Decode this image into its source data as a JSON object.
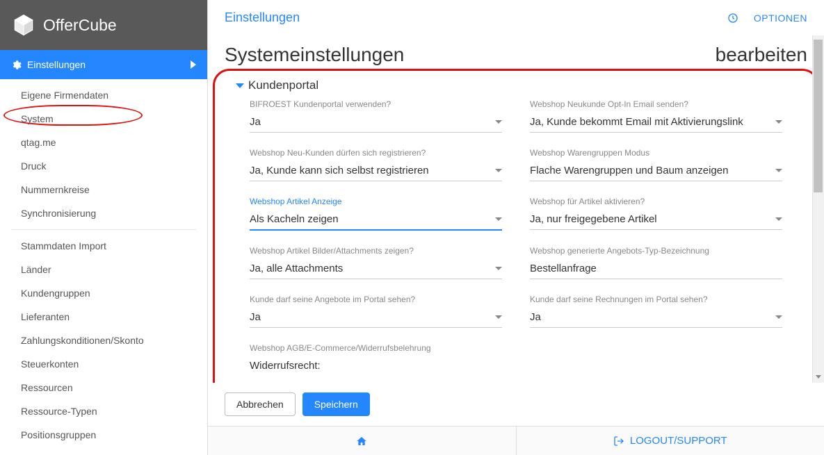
{
  "app_name": "OfferCube",
  "sidebar": {
    "primary": "Einstellungen",
    "items": [
      "Eigene Firmendaten",
      "System",
      "qtag.me",
      "Druck",
      "Nummernkreise",
      "Synchronisierung",
      "Stammdaten Import",
      "Länder",
      "Kundengruppen",
      "Lieferanten",
      "Zahlungskonditionen/Skonto",
      "Steuerkonten",
      "Ressourcen",
      "Ressource-Typen",
      "Positionsgruppen"
    ]
  },
  "topbar": {
    "title": "Einstellungen",
    "options": "OPTIONEN"
  },
  "page": {
    "heading": "Systemeinstellungen",
    "action": "bearbeiten"
  },
  "section": {
    "title": "Kundenportal"
  },
  "fields": {
    "bifroest_label": "BIFROEST Kundenportal verwenden?",
    "bifroest_value": "Ja",
    "neukunde_optin_label": "Webshop Neukunde Opt-In Email senden?",
    "neukunde_optin_value": "Ja, Kunde bekommt Email mit Aktivierungslink",
    "neukunden_reg_label": "Webshop Neu-Kunden dürfen sich registrieren?",
    "neukunden_reg_value": "Ja, Kunde kann sich selbst registrieren",
    "warengruppen_label": "Webshop Warengruppen Modus",
    "warengruppen_value": "Flache Warengruppen und Baum anzeigen",
    "artikel_anzeige_label": "Webshop Artikel Anzeige",
    "artikel_anzeige_value": "Als Kacheln zeigen",
    "artikel_aktivieren_label": "Webshop für Artikel aktivieren?",
    "artikel_aktivieren_value": "Ja, nur freigegebene Artikel",
    "bilder_label": "Webshop Artikel Bilder/Attachments zeigen?",
    "bilder_value": "Ja, alle Attachments",
    "angebot_typ_label": "Webshop generierte Angebots-Typ-Bezeichnung",
    "angebot_typ_value": "Bestellanfrage",
    "angebote_portal_label": "Kunde darf seine Angebote im Portal sehen?",
    "angebote_portal_value": "Ja",
    "rechnungen_portal_label": "Kunde darf seine Rechnungen im Portal sehen?",
    "rechnungen_portal_value": "Ja",
    "agb_label": "Webshop AGB/E-Commerce/Widerrufsbelehrung",
    "agb_value": "Widerrufsrecht:"
  },
  "buttons": {
    "cancel": "Abbrechen",
    "save": "Speichern"
  },
  "footer": {
    "logout": "LOGOUT/SUPPORT"
  }
}
